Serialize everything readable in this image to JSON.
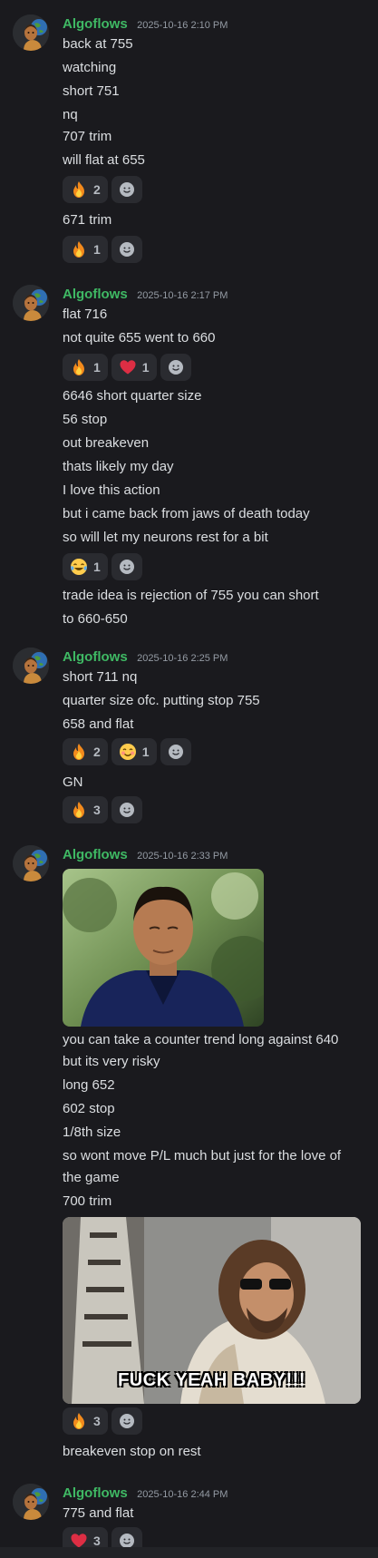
{
  "colors": {
    "background": "#1a1a1e",
    "author": "#3fb964",
    "timestamp": "#949ba4",
    "text": "#dbdee1",
    "reaction_bg": "#2a2b30"
  },
  "messages": [
    {
      "author": "Algoflows",
      "timestamp": "2025-10-16 2:10 PM",
      "lines": [
        "back at 755",
        "watching",
        "short 751",
        "nq",
        "707 trim",
        "will flat at 655"
      ],
      "reactions_a": [
        {
          "emoji": "fire-emoji",
          "count": "2"
        }
      ],
      "lines2": [
        "671 trim"
      ],
      "reactions_b": [
        {
          "emoji": "fire-emoji",
          "count": "1"
        }
      ]
    },
    {
      "author": "Algoflows",
      "timestamp": "2025-10-16 2:17 PM",
      "lines": [
        "flat 716",
        "not quite 655 went to 660"
      ],
      "reactions_a": [
        {
          "emoji": "fire-emoji",
          "count": "1"
        },
        {
          "emoji": "heart-emoji",
          "count": "1"
        }
      ],
      "lines2": [
        "6646 short quarter size",
        "56 stop",
        "out breakeven",
        "thats likely my day",
        "I love this action",
        "but i came back from jaws of death today",
        "so will let my neurons rest for a bit"
      ],
      "reactions_b": [
        {
          "emoji": "joy-emoji",
          "count": "1"
        }
      ],
      "lines3": [
        "trade idea is rejection of 755 you can short",
        "to 660-650"
      ]
    },
    {
      "author": "Algoflows",
      "timestamp": "2025-10-16 2:25 PM",
      "lines": [
        "short 711 nq",
        "quarter size ofc. putting stop 755",
        "658 and flat"
      ],
      "reactions_a": [
        {
          "emoji": "fire-emoji",
          "count": "2"
        },
        {
          "emoji": "blush-emoji",
          "count": "1"
        }
      ],
      "lines2": [
        "GN"
      ],
      "reactions_b": [
        {
          "emoji": "fire-emoji",
          "count": "3"
        }
      ]
    },
    {
      "author": "Algoflows",
      "timestamp": "2025-10-16 2:33 PM",
      "lines": [
        "you can take a counter trend long against 640",
        "but its very risky",
        "long 652",
        "602 stop",
        "1/8th size",
        "so wont move P/L much but just for the love of",
        "the game",
        "700 trim"
      ],
      "gif_caption": "FUCK YEAH BABY!!!",
      "reactions_a": [
        {
          "emoji": "fire-emoji",
          "count": "3"
        }
      ],
      "lines2": [
        "breakeven stop on rest"
      ]
    },
    {
      "author": "Algoflows",
      "timestamp": "2025-10-16 2:44 PM",
      "lines": [
        "775 and flat"
      ],
      "reactions_a": [
        {
          "emoji": "heart-emoji",
          "count": "3"
        }
      ]
    }
  ]
}
